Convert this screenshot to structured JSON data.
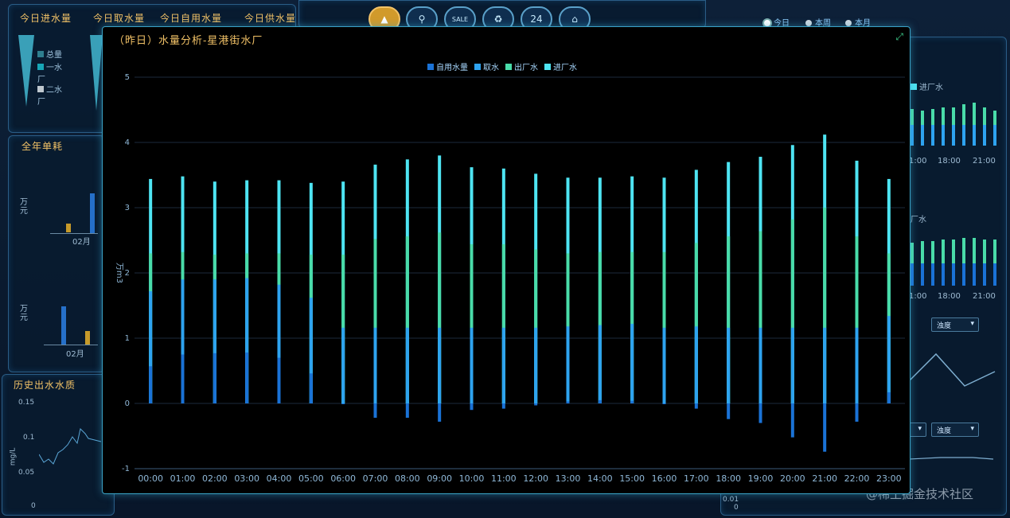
{
  "top_panel": {
    "tabs": [
      "今日进水量",
      "今日取水量",
      "今日自用水量",
      "今日供水量"
    ],
    "legend": [
      "总量",
      "一水厂",
      "二水厂"
    ]
  },
  "nav_icons": [
    {
      "name": "plant-icon",
      "label": "",
      "active": true
    },
    {
      "name": "tap-icon",
      "label": "",
      "active": false
    },
    {
      "name": "sale-icon",
      "label": "SALE",
      "active": false
    },
    {
      "name": "recycle-icon",
      "label": "♻",
      "active": false
    },
    {
      "name": "clock24-icon",
      "label": "24",
      "active": false
    },
    {
      "name": "home-icon",
      "label": "⌂",
      "active": false
    }
  ],
  "period_radios": [
    {
      "label": "今日",
      "selected": true
    },
    {
      "label": "本周",
      "selected": false
    },
    {
      "label": "本月",
      "selected": false
    }
  ],
  "left_middle": {
    "title": "全年单耗",
    "unit": "万元",
    "month": "02月"
  },
  "left_bottom": {
    "title": "历史出水水质",
    "ylabel": "mg/L",
    "yticks": [
      "0.15",
      "0.1",
      "0.05",
      "0"
    ]
  },
  "right_panel": {
    "legend": "进厂水",
    "legend2": "厂水",
    "x_ticks_a": [
      "1:00",
      "18:00",
      "21:00"
    ],
    "x_ticks_b": [
      "1:00",
      "18:00",
      "21:00"
    ],
    "select_a": "浊度",
    "select_b": "浊度",
    "small_ticks": [
      "0.01",
      "0"
    ]
  },
  "watermark": "@稀土掘金技术社区",
  "modal": {
    "title": "（昨日）水量分析-星港街水厂",
    "expand_icon": "⤢"
  },
  "chart_data": {
    "type": "bar",
    "ylabel": "万m3",
    "ylim": [
      -1,
      5
    ],
    "yticks": [
      -1,
      0,
      1,
      2,
      3,
      4,
      5
    ],
    "categories": [
      "00:00",
      "01:00",
      "02:00",
      "03:00",
      "04:00",
      "05:00",
      "06:00",
      "07:00",
      "08:00",
      "09:00",
      "10:00",
      "11:00",
      "12:00",
      "13:00",
      "14:00",
      "15:00",
      "16:00",
      "17:00",
      "18:00",
      "19:00",
      "20:00",
      "21:00",
      "22:00",
      "23:00"
    ],
    "colors": {
      "自用水量": "#1a72d6",
      "取水": "#2ea3f0",
      "出厂水": "#49dca9",
      "进厂水": "#4ee4f2"
    },
    "series": [
      {
        "name": "自用水量",
        "values": [
          0.57,
          0.75,
          0.77,
          0.78,
          0.7,
          0.46,
          0,
          -0.22,
          -0.22,
          -0.28,
          -0.1,
          -0.08,
          -0.03,
          0.03,
          0.05,
          0.04,
          0,
          -0.08,
          -0.24,
          -0.3,
          -0.52,
          -0.74,
          -0.28,
          0.17
        ]
      },
      {
        "name": "取水",
        "values": [
          1.72,
          1.9,
          1.9,
          1.92,
          1.82,
          1.62,
          1.16,
          1.16,
          1.16,
          1.16,
          1.16,
          1.16,
          1.16,
          1.18,
          1.2,
          1.22,
          1.16,
          1.18,
          1.16,
          1.16,
          1.16,
          1.16,
          1.16,
          1.34
        ]
      },
      {
        "name": "出厂水",
        "values": [
          2.3,
          2.32,
          2.28,
          2.3,
          2.3,
          2.28,
          2.28,
          2.52,
          2.56,
          2.62,
          2.44,
          2.44,
          2.36,
          2.3,
          2.32,
          2.32,
          2.32,
          2.46,
          2.56,
          2.64,
          2.82,
          3.0,
          2.56,
          2.3
        ]
      },
      {
        "name": "进厂水",
        "values": [
          3.44,
          3.48,
          3.4,
          3.42,
          3.42,
          3.38,
          3.4,
          3.66,
          3.74,
          3.8,
          3.62,
          3.6,
          3.52,
          3.46,
          3.46,
          3.48,
          3.46,
          3.58,
          3.7,
          3.78,
          3.96,
          4.12,
          3.72,
          3.44
        ]
      }
    ],
    "legend_position": "top-center",
    "grid": true
  }
}
